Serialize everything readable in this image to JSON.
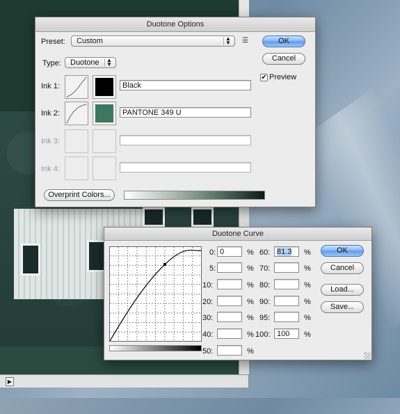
{
  "duotone_options": {
    "title": "Duotone Options",
    "preset_label": "Preset:",
    "preset_value": "Custom",
    "type_label": "Type:",
    "type_value": "Duotone",
    "ok_label": "OK",
    "cancel_label": "Cancel",
    "preview_label": "Preview",
    "preview_checked": true,
    "inks": [
      {
        "label": "Ink 1:",
        "name": "Black",
        "color": "#000000",
        "enabled": true
      },
      {
        "label": "Ink 2:",
        "name": "PANTONE 349 U",
        "color": "#3f7660",
        "enabled": true
      },
      {
        "label": "Ink 3:",
        "name": "",
        "color": "",
        "enabled": false
      },
      {
        "label": "Ink 4:",
        "name": "",
        "color": "",
        "enabled": false
      }
    ],
    "overprint_label": "Overprint Colors..."
  },
  "duotone_curve": {
    "title": "Duotone Curve",
    "ok_label": "OK",
    "cancel_label": "Cancel",
    "load_label": "Load...",
    "save_label": "Save...",
    "percent_sign": "%",
    "fields_left": [
      {
        "label": "0:",
        "value": "0"
      },
      {
        "label": "5:",
        "value": ""
      },
      {
        "label": "10:",
        "value": ""
      },
      {
        "label": "20:",
        "value": ""
      },
      {
        "label": "30:",
        "value": ""
      },
      {
        "label": "40:",
        "value": ""
      },
      {
        "label": "50:",
        "value": ""
      }
    ],
    "fields_right": [
      {
        "label": "60:",
        "value": "81.3"
      },
      {
        "label": "70:",
        "value": ""
      },
      {
        "label": "80:",
        "value": ""
      },
      {
        "label": "90:",
        "value": ""
      },
      {
        "label": "95:",
        "value": ""
      },
      {
        "label": "100:",
        "value": "100"
      }
    ]
  }
}
